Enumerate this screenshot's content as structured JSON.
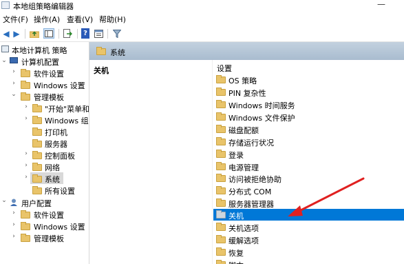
{
  "window": {
    "title": "本地组策略编辑器",
    "minimize": "—"
  },
  "menu": [
    "文件(F)",
    "操作(A)",
    "查看(V)",
    "帮助(H)"
  ],
  "toolbar_icons": [
    "back-arrow-icon",
    "forward-arrow-icon",
    "up-folder-icon",
    "show-tree-icon",
    "export-icon",
    "help-icon",
    "properties-icon",
    "filter-icon"
  ],
  "tree": [
    {
      "label": "本地计算机 策略",
      "level": 0,
      "chevron": "",
      "icon": "computer-policy"
    },
    {
      "label": "计算机配置",
      "level": 1,
      "chevron": "v",
      "icon": "computer"
    },
    {
      "label": "软件设置",
      "level": 2,
      "chevron": ">",
      "icon": "folder"
    },
    {
      "label": "Windows 设置",
      "level": 2,
      "chevron": ">",
      "icon": "folder"
    },
    {
      "label": "管理模板",
      "level": 2,
      "chevron": "v",
      "icon": "folder"
    },
    {
      "label": "\"开始\"菜单和",
      "level": 3,
      "chevron": ">",
      "icon": "folder"
    },
    {
      "label": "Windows 组",
      "level": 3,
      "chevron": ">",
      "icon": "folder"
    },
    {
      "label": "打印机",
      "level": 3,
      "chevron": "",
      "icon": "folder"
    },
    {
      "label": "服务器",
      "level": 3,
      "chevron": "",
      "icon": "folder"
    },
    {
      "label": "控制面板",
      "level": 3,
      "chevron": ">",
      "icon": "folder"
    },
    {
      "label": "网络",
      "level": 3,
      "chevron": ">",
      "icon": "folder"
    },
    {
      "label": "系统",
      "level": 3,
      "chevron": ">",
      "icon": "folder",
      "selected": true
    },
    {
      "label": "所有设置",
      "level": 3,
      "chevron": "",
      "icon": "folder"
    },
    {
      "label": "用户配置",
      "level": 1,
      "chevron": "v",
      "icon": "user"
    },
    {
      "label": "软件设置",
      "level": 2,
      "chevron": ">",
      "icon": "folder"
    },
    {
      "label": "Windows 设置",
      "level": 2,
      "chevron": ">",
      "icon": "folder"
    },
    {
      "label": "管理模板",
      "level": 2,
      "chevron": ">",
      "icon": "folder"
    }
  ],
  "right_pane": {
    "header": "系统",
    "section_title": "关机",
    "column_header": "设置",
    "settings": [
      "OS 策略",
      "PIN 复杂性",
      "Windows 时间服务",
      "Windows 文件保护",
      "磁盘配额",
      "存储运行状况",
      "登录",
      "电源管理",
      "访问被拒绝协助",
      "分布式 COM",
      "服务器管理器",
      "关机",
      "关机选项",
      "缓解选项",
      "恢复",
      "脚本"
    ],
    "selected_setting": "关机"
  },
  "colors": {
    "selection_blue": "#0078d7",
    "arrow_red": "#e02020",
    "folder_yellow": "#e9c46a"
  }
}
